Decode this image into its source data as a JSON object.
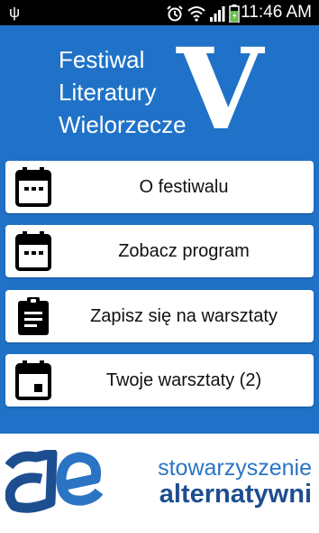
{
  "status_bar": {
    "time": "11:46 AM",
    "icons": [
      "usb-icon",
      "alarm-icon",
      "wifi-icon",
      "signal-icon",
      "battery-icon"
    ]
  },
  "header": {
    "title_lines": [
      "Festiwal",
      "Literatury",
      "Wielorzecze"
    ],
    "big_letter": "V"
  },
  "menu": [
    {
      "label": "O festiwalu",
      "icon": "calendar-icon"
    },
    {
      "label": "Zobacz program",
      "icon": "calendar-icon"
    },
    {
      "label": "Zapisz się na warsztaty",
      "icon": "clipboard-icon"
    },
    {
      "label": "Twoje warsztaty (2)",
      "icon": "calendar-event-icon"
    }
  ],
  "footer": {
    "org_line1": "stowarzyszenie",
    "org_line2": "alternatywni"
  },
  "colors": {
    "primary_blue": "#1f72c7",
    "logo_light_blue": "#2b74c4",
    "logo_dark_blue": "#1d4e90"
  }
}
